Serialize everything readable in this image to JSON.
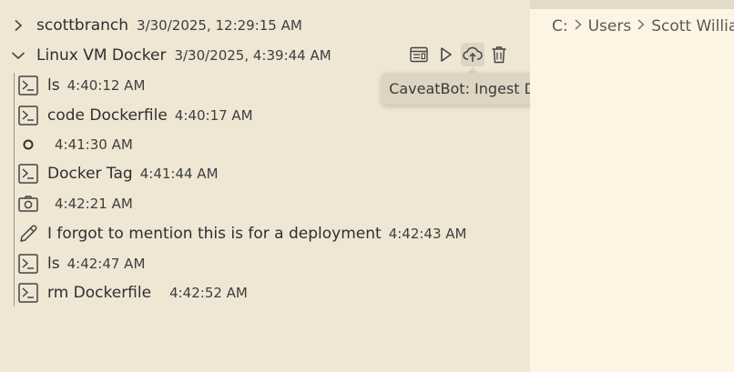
{
  "sessions": [
    {
      "title": "scottbranch",
      "timestamp": "3/30/2025, 12:29:15 AM",
      "expanded": false,
      "chevron_icon": "chevron-right-icon"
    },
    {
      "title": "Linux VM Docker",
      "timestamp": "3/30/2025, 4:39:44 AM",
      "expanded": true,
      "chevron_icon": "chevron-down-icon",
      "actions": [
        {
          "name": "open-session-button",
          "icon": "session-browser-icon"
        },
        {
          "name": "run-session-button",
          "icon": "play-icon"
        },
        {
          "name": "ingest-data-button",
          "icon": "cloud-upload-icon"
        },
        {
          "name": "delete-session-button",
          "icon": "trash-icon"
        }
      ],
      "entries": [
        {
          "icon": "terminal-icon",
          "label": "ls",
          "time": "4:40:12 AM"
        },
        {
          "icon": "terminal-icon",
          "label": "code Dockerfile",
          "time": "4:40:17 AM"
        },
        {
          "icon": "circle-icon",
          "label": "",
          "time": "4:41:30 AM"
        },
        {
          "icon": "terminal-icon",
          "label": "Docker Tag",
          "time": "4:41:44 AM"
        },
        {
          "icon": "camera-icon",
          "label": "",
          "time": "4:42:21 AM"
        },
        {
          "icon": "pencil-icon",
          "label": "I forgot to mention this is for a deployment",
          "time": "4:42:43 AM"
        },
        {
          "icon": "terminal-icon",
          "label": "ls",
          "time": "4:42:47 AM"
        },
        {
          "icon": "terminal-icon",
          "label": "rm Dockerfile",
          "time": "4:42:52 AM"
        }
      ]
    }
  ],
  "tooltip": {
    "text": "CaveatBot: Ingest Data"
  },
  "breadcrumb": [
    "C:",
    "Users",
    "Scott Willia"
  ],
  "colors": {
    "sidebar_bg": "#efe6d4",
    "editor_bg": "#fdf4e3",
    "tooltip_bg": "#ddd4c2"
  }
}
